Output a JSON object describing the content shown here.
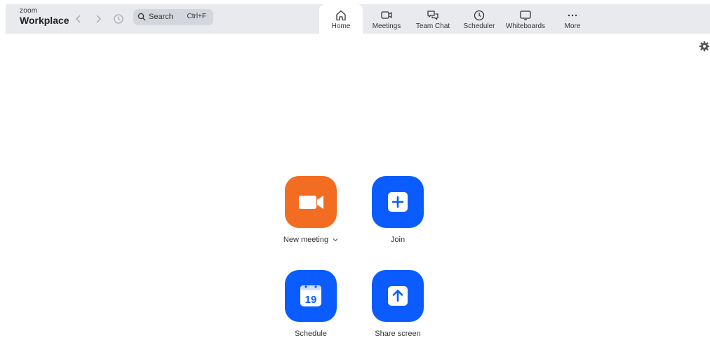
{
  "app": {
    "brand_small": "zoom",
    "brand_big": "Workplace"
  },
  "search": {
    "label": "Search",
    "shortcut": "Ctrl+F"
  },
  "tabs": [
    {
      "label": "Home",
      "icon": "home-icon",
      "active": true
    },
    {
      "label": "Meetings",
      "icon": "video-icon"
    },
    {
      "label": "Team Chat",
      "icon": "chat-icon"
    },
    {
      "label": "Scheduler",
      "icon": "clock-icon"
    },
    {
      "label": "Whiteboards",
      "icon": "whiteboard-icon"
    },
    {
      "label": "More",
      "icon": "more-icon"
    }
  ],
  "actions": {
    "new_meeting": {
      "label": "New meeting",
      "icon": "video-camera-icon",
      "color": "#f26d21"
    },
    "join": {
      "label": "Join",
      "icon": "plus-icon",
      "color": "#0b5cff"
    },
    "schedule": {
      "label": "Schedule",
      "icon": "calendar-icon",
      "day": "19",
      "color": "#0b5cff"
    },
    "share_screen": {
      "label": "Share screen",
      "icon": "upload-arrow-icon",
      "color": "#0b5cff"
    }
  },
  "colors": {
    "topbar_bg": "#e8eaee",
    "accent_blue": "#0b5cff",
    "accent_orange": "#f26d21"
  }
}
